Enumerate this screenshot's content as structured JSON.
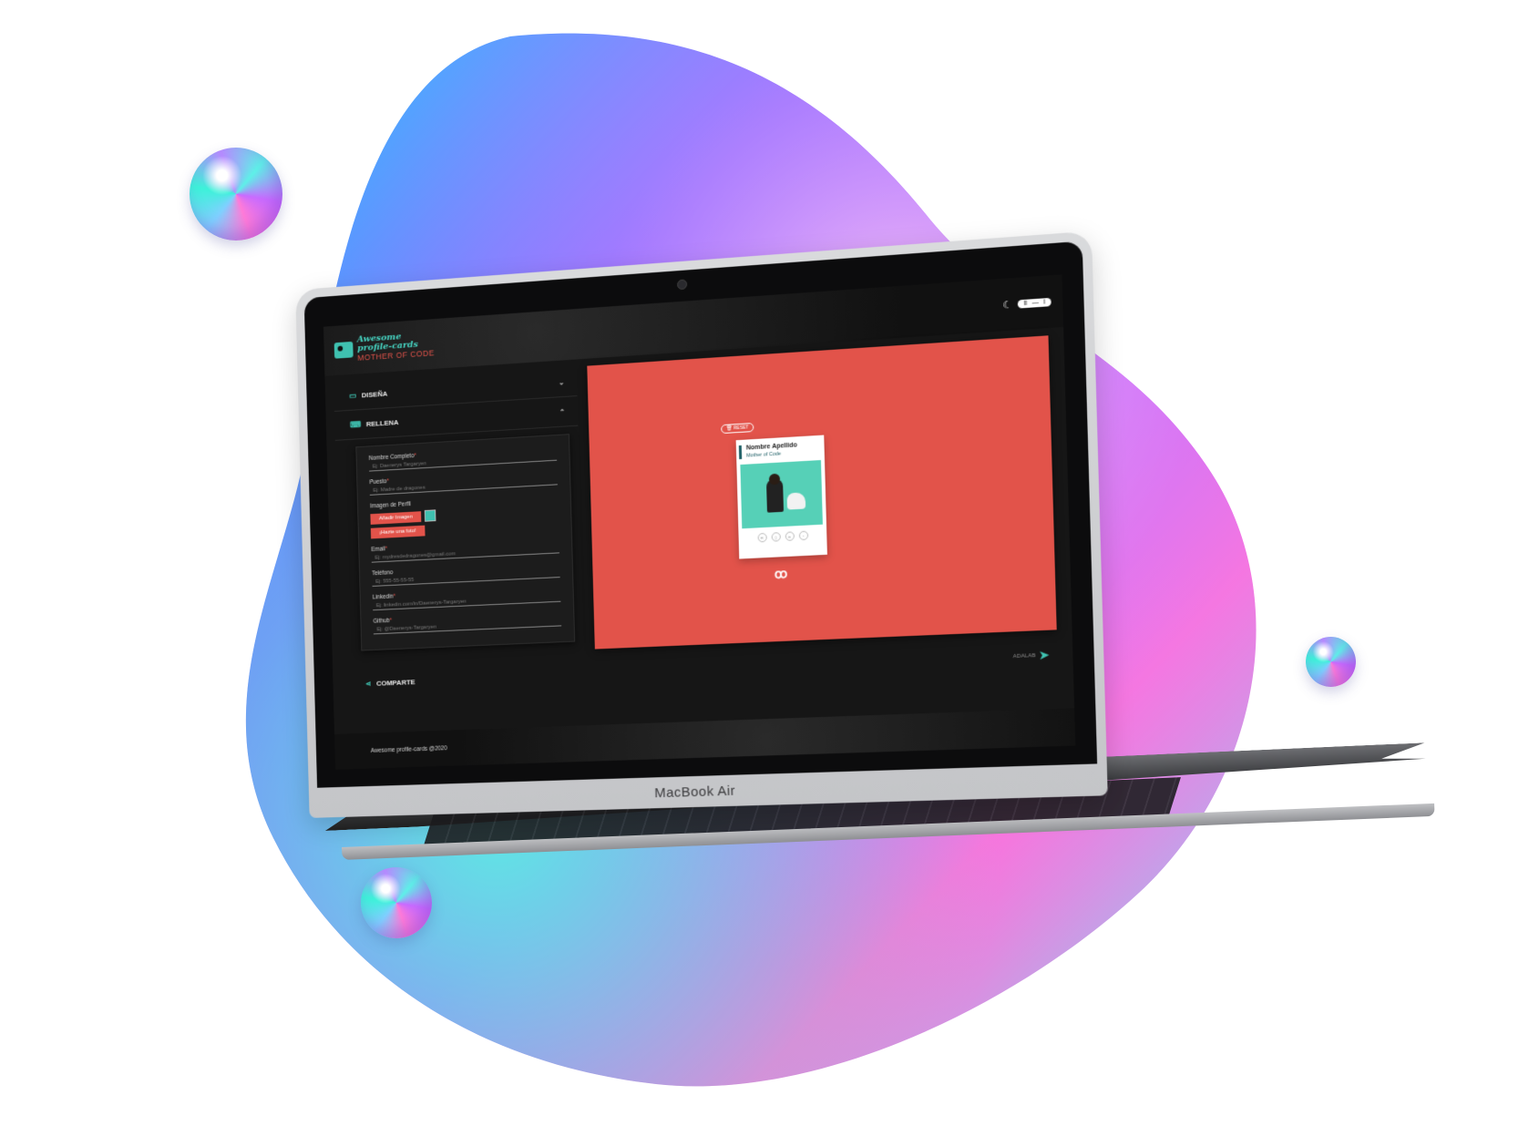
{
  "device": {
    "label": "MacBook Air"
  },
  "app": {
    "logo": {
      "line1": "Awesome",
      "line2": "profile-cards",
      "sub": "MOTHER OF CODE"
    },
    "header": {
      "theme_icon": "moon-icon",
      "toggle_items": [
        "II",
        "—",
        "I"
      ]
    },
    "sections": {
      "design": {
        "label": "DISEÑA",
        "icon": "palette-icon"
      },
      "fill": {
        "label": "RELLENA",
        "icon": "keyboard-icon"
      },
      "share": {
        "label": "COMPARTE",
        "icon": "share-icon"
      }
    },
    "form": {
      "full_name": {
        "label": "Nombre Completo",
        "required": "*",
        "placeholder": "Ej: Daenerys Targaryen"
      },
      "job": {
        "label": "Puesto",
        "required": "*",
        "placeholder": "Ej: Madre de dragones"
      },
      "image": {
        "label": "Imagen de Perfil",
        "add_button": "Añadir Imagen",
        "photo_button": "¡Hazte una foto!"
      },
      "email": {
        "label": "Email",
        "required": "*",
        "placeholder": "Ej: mydresdedragones@gmail.com"
      },
      "phone": {
        "label": "Teléfono",
        "placeholder": "Ej: 555-55-55-55"
      },
      "linkedin": {
        "label": "Linkedin",
        "required": "*",
        "placeholder": "Ej: linkedin.com/in/Daenerys-Targaryen"
      },
      "github": {
        "label": "Github",
        "required": "*",
        "placeholder": "Ej: @Daenerys-Targaryen"
      }
    },
    "preview": {
      "reset": "RESET",
      "card": {
        "name": "Nombre Apellido",
        "job": "Mother of Code"
      },
      "contact_icons": [
        "mail-icon",
        "phone-icon",
        "linkedin-icon",
        "github-icon"
      ],
      "colors": {
        "background": "#e2534a",
        "card_image": "#56d0b7",
        "accent": "#1e5f66"
      }
    },
    "adalab": "ADALAB",
    "footer": "Awesome profile-cards @2020",
    "colors": {
      "accent": "#3fc1b0",
      "brand_red": "#e2534a",
      "dark": "#161616"
    }
  }
}
